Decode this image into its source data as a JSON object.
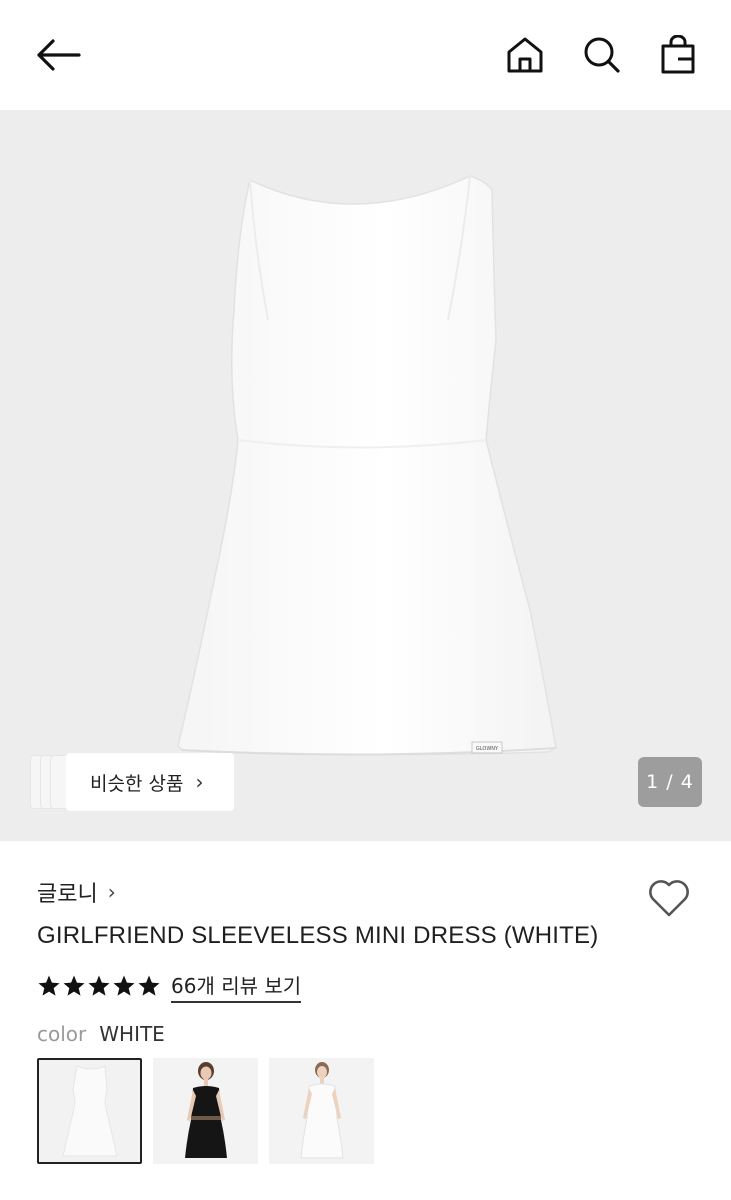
{
  "header": {
    "back_icon": "arrow-left-icon",
    "home_icon": "home-icon",
    "search_icon": "search-icon",
    "bag_icon": "shopping-bag-icon"
  },
  "hero": {
    "pager": "1 / 4",
    "similar_label": "비슷한 상품",
    "similar_chevron": "›",
    "tag_text": "GLOWNY",
    "background": "#ededee"
  },
  "product": {
    "brand": "글로니",
    "brand_chevron": "›",
    "title": "GIRLFRIEND SLEEVELESS MINI DRESS (WHITE)",
    "rating": 5,
    "review_link": "66개 리뷰 보기",
    "color_label": "color",
    "color_value": "WHITE",
    "swatches": [
      {
        "name": "white-dress-flat",
        "selected": true
      },
      {
        "name": "black-dress-model",
        "selected": false
      },
      {
        "name": "white-dress-model",
        "selected": false
      }
    ]
  }
}
